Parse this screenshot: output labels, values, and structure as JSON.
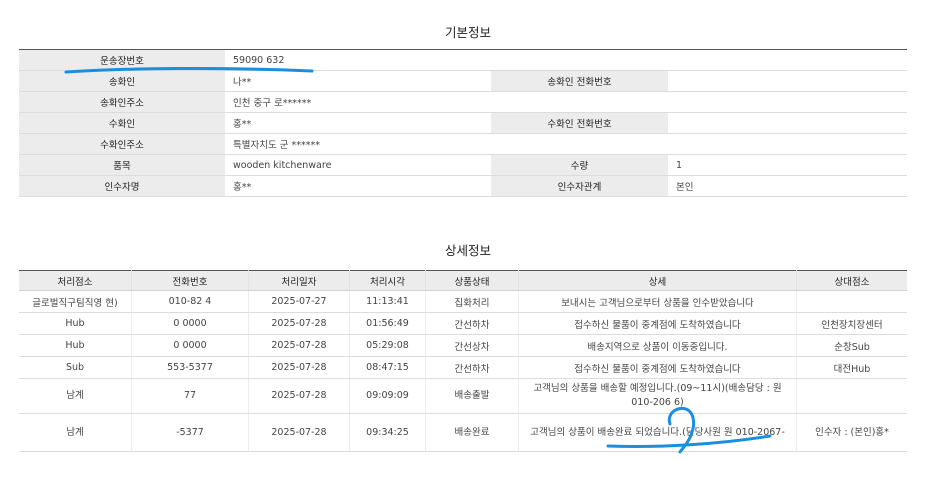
{
  "basic": {
    "title": "기본정보",
    "tracking_label": "운송장번호",
    "tracking_value": "59090 632",
    "sender_label": "송화인",
    "sender_value": "나**",
    "sender_phone_label": "송화인 전화번호",
    "sender_phone_value": "",
    "sender_addr_label": "송화인주소",
    "sender_addr_value": "인천 중구 로******",
    "receiver_label": "수화인",
    "receiver_value": "홍**",
    "receiver_phone_label": "수화인 전화번호",
    "receiver_phone_value": "",
    "receiver_addr_label": "수화인주소",
    "receiver_addr_value": "특별자치도 군 ******",
    "item_label": "품목",
    "item_value": "wooden kitchenware",
    "qty_label": "수량",
    "qty_value": "1",
    "recipient_label": "인수자명",
    "recipient_value": "홍**",
    "relation_label": "인수자관계",
    "relation_value": "본인"
  },
  "detail": {
    "title": "상세정보",
    "headers": [
      "처리점소",
      "전화번호",
      "처리일자",
      "처리시각",
      "상품상태",
      "상세",
      "상대점소"
    ],
    "rows": [
      {
        "branch": "글로벌직구팀직영 현)",
        "phone": "010-82 4",
        "date": "2025-07-27",
        "time": "11:13:41",
        "status": "집화처리",
        "detail": "보내시는 고객님으로부터 상품을 인수받았습니다",
        "partner": ""
      },
      {
        "branch": "Hub",
        "phone": "0 0000",
        "date": "2025-07-28",
        "time": "01:56:49",
        "status": "간선하차",
        "detail": "접수하신 물품이 중계점에 도착하였습니다",
        "partner": "인천장치장센터"
      },
      {
        "branch": "Hub",
        "phone": "0 0000",
        "date": "2025-07-28",
        "time": "05:29:08",
        "status": "간선상차",
        "detail": "배송지역으로 상품이 이동중입니다.",
        "partner": "순창Sub"
      },
      {
        "branch": "Sub",
        "phone": "553-5377",
        "date": "2025-07-28",
        "time": "08:47:15",
        "status": "간선하차",
        "detail": "접수하신 물품이 중계점에 도착하였습니다",
        "partner": "대전Hub"
      },
      {
        "branch": "남계",
        "phone": "77",
        "date": "2025-07-28",
        "time": "09:09:09",
        "status": "배송출발",
        "detail": "고객님의 상품을 배송할 예정입니다.(09~11시)(배송담당 : 원 010-206 6)",
        "partner": ""
      },
      {
        "branch": "남계",
        "phone": "-5377",
        "date": "2025-07-28",
        "time": "09:34:25",
        "status": "배송완료",
        "detail": "고객님의 상품이 배송완료 되었습니다.(담당사원 원 010-2067-",
        "partner": "인수자 : (본인)홍*"
      }
    ]
  },
  "colors": {
    "annotation": "#1a8fe0"
  }
}
